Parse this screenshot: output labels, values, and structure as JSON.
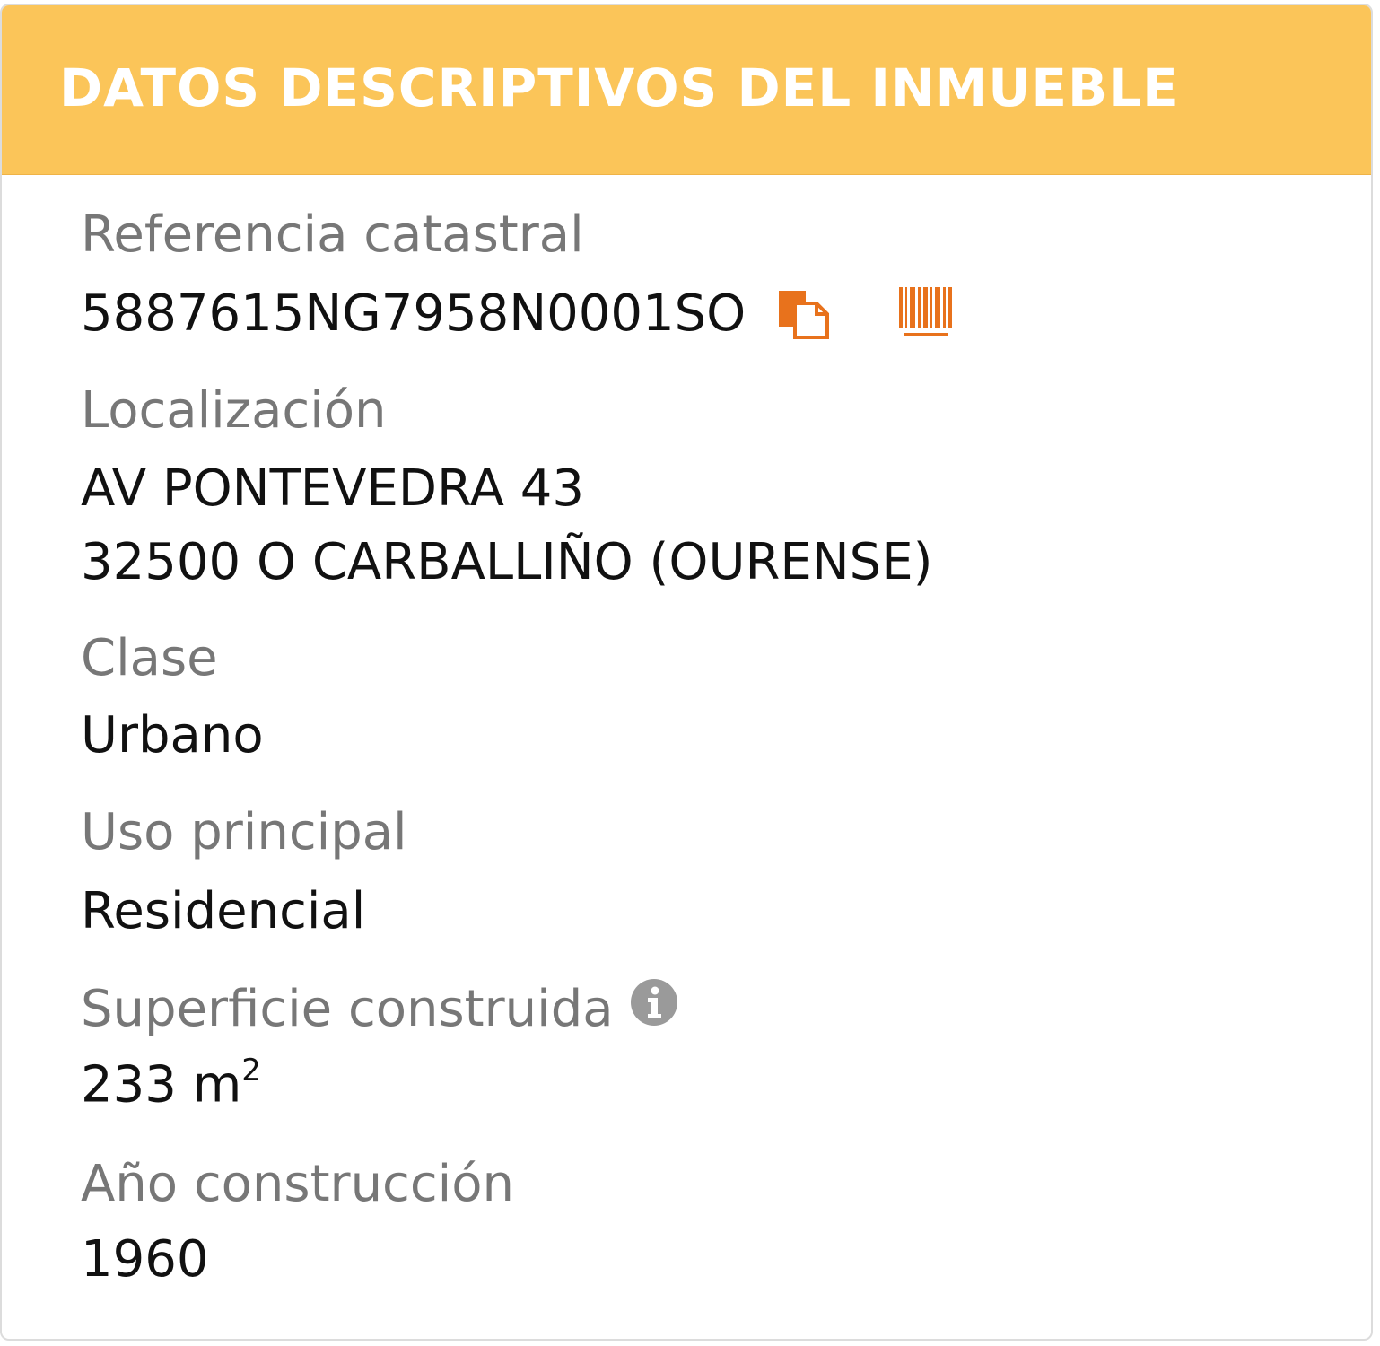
{
  "header": {
    "title": "DATOS DESCRIPTIVOS DEL INMUEBLE"
  },
  "fields": {
    "referencia": {
      "label": "Referencia catastral",
      "value": "5887615NG7958N0001SO",
      "copy_icon": "copy-icon",
      "barcode_icon": "barcode-icon"
    },
    "localizacion": {
      "label": "Localización",
      "line1": "AV PONTEVEDRA 43",
      "line2": "32500 O CARBALLIÑO (OURENSE)"
    },
    "clase": {
      "label": "Clase",
      "value": "Urbano"
    },
    "uso": {
      "label": "Uso principal",
      "value": "Residencial"
    },
    "superficie": {
      "label": "Superficie construida",
      "value": "233 m",
      "unit_exponent": "2",
      "info_icon": "info-icon"
    },
    "anio": {
      "label": "Año construcción",
      "value": "1960"
    }
  },
  "colors": {
    "header_bg": "#fbc559",
    "header_text": "#ffffff",
    "label_text": "#777777",
    "value_text": "#111111",
    "icon_orange": "#e8721c",
    "info_gray": "#9a9a9a"
  }
}
